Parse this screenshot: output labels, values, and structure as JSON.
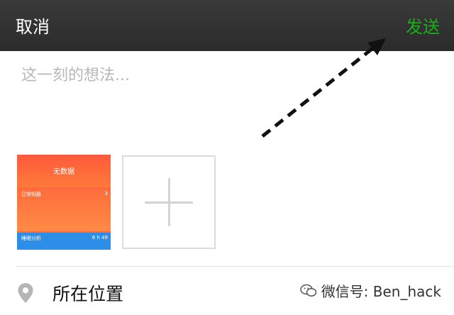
{
  "header": {
    "cancel_label": "取消",
    "send_label": "发送"
  },
  "compose": {
    "placeholder": "这一刻的想法..."
  },
  "thumbnail": {
    "top_text": "无数据",
    "middle_label": "日常相册",
    "middle_value": "3",
    "bottom_label": "睡眠分析",
    "bottom_value": "6 h 49"
  },
  "location": {
    "label": "所在位置"
  },
  "watermark": {
    "text": "微信号: Ben_hack"
  },
  "colors": {
    "topbar": "#2f2f2f",
    "send_green": "#1aad19",
    "placeholder_gray": "#b8b8b8"
  }
}
